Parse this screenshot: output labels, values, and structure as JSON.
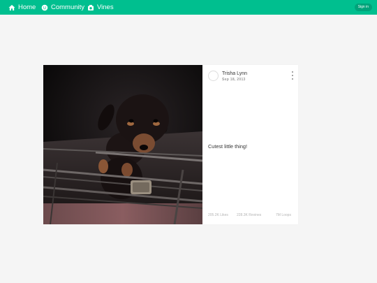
{
  "nav": {
    "home_label": "Home",
    "community_label": "Community",
    "vines_label": "Vines",
    "signin_label": "Sign in"
  },
  "post": {
    "author": "Trisha Lynn",
    "date": "Sep 18, 2013",
    "caption": "Cutest little thing!",
    "likes": "205.2K Likes",
    "revines": "228.3K Revines",
    "loops": "7M Loops"
  },
  "colors": {
    "brand": "#00bf8f",
    "background": "#f5f5f5"
  },
  "icons": {
    "home": "home-icon",
    "community": "community-icon",
    "vines": "vines-icon",
    "more": "more-vertical-icon"
  }
}
